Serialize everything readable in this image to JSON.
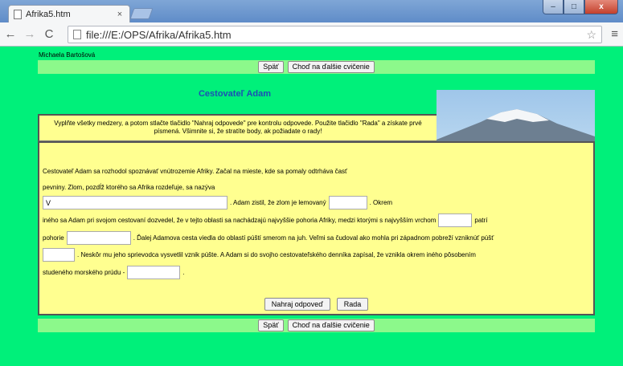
{
  "browser": {
    "tab_title": "Afrika5.htm",
    "tab_close": "×",
    "url": "file:///E:/OPS/Afrika/Afrika5.htm",
    "back_icon": "←",
    "forward_icon": "→",
    "reload_icon": "C",
    "star_icon": "☆",
    "menu_icon": "≡",
    "window_minimize": "–",
    "window_maximize": "□",
    "window_close": "x"
  },
  "page": {
    "author": "Michaela Bartošová",
    "nav_top": {
      "back_label": "Späť",
      "next_label": "Choď na ďalšie cvičenie"
    },
    "nav_bottom": {
      "back_label": "Späť",
      "next_label": "Choď na ďalšie cvičenie"
    },
    "title": "Cestovateľ Adam",
    "instructions": "Vyplňte všetky medzery, a potom stlačte tlačidlo \"Nahraj odpovede\" pre kontrolu odpovede. Použite tlačidlo \"Rada\" a získate prvé písmená. Všimnite si, že stratíte body, ak požiadate o rady!",
    "text": {
      "line1": "Cestovateľ Adam sa rozhodol spoznávať vnútrozemie Afriky. Začal na mieste, kde sa pomaly odtrháva časť",
      "line2": "pevniny. Zlom, pozdĺž ktorého sa Afrika rozdeľuje, sa nazýva",
      "seg3a": ". Adam zistil, že zlom je lemovaný",
      "seg3b": ". Okrem",
      "seg4a": "iného sa Adam pri svojom cestovaní dozvedel, že v tejto oblasti sa nachádzajú najvyššie pohoria Afriky, medzi ktorými s najvyšším vrchom",
      "seg4b": "patrí",
      "seg5a": "pohorie",
      "seg5b": ". Ďalej Adamova cesta viedla do oblastí púští smerom na juh. Veľmi sa čudoval ako mohla pri západnom pobreží vzniknúť púšť",
      "seg6": ". Neskôr mu jeho sprievodca vysvetlil vznik púšte. A Adam si do svojho cestovateľského denníka zapísal, že vznikla okrem iného pôsobením",
      "seg7a": "studeného morského prúdu -",
      "seg7b": "."
    },
    "gaps": {
      "gap1": "V",
      "gap2": "",
      "gap3": "",
      "gap4": "",
      "gap5": "",
      "gap6": ""
    },
    "buttons": {
      "check": "Nahraj odpoveď",
      "hint": "Rada"
    }
  }
}
